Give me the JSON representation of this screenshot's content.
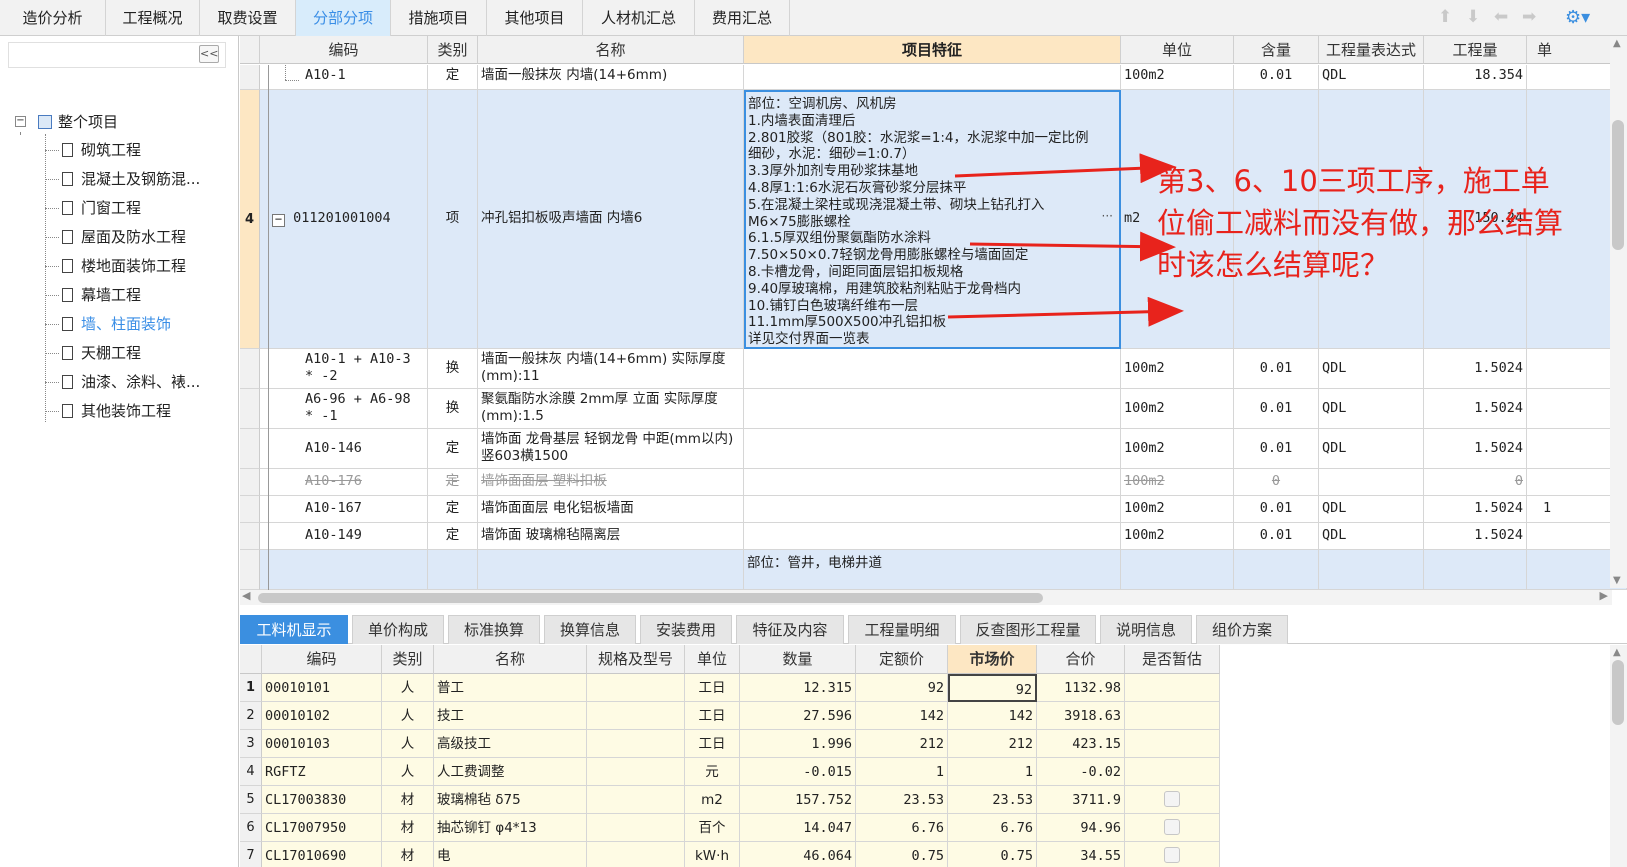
{
  "top_tabs": [
    "造价分析",
    "工程概况",
    "取费设置",
    "分部分项",
    "措施项目",
    "其他项目",
    "人材机汇总",
    "费用汇总"
  ],
  "active_top_tab": "分部分项",
  "toolbar_icons": [
    "arrow-up-icon",
    "arrow-down-icon",
    "arrow-left-icon",
    "arrow-right-icon",
    "settings-icon"
  ],
  "sidebar": {
    "collapse_label": "<<",
    "root": "整个项目",
    "items": [
      "砌筑工程",
      "混凝土及钢筋混...",
      "门窗工程",
      "屋面及防水工程",
      "楼地面装饰工程",
      "幕墙工程",
      "墙、柱面装饰",
      "天棚工程",
      "油漆、涂料、裱...",
      "其他装饰工程"
    ],
    "active_item": "墙、柱面装饰"
  },
  "main_table": {
    "headers": [
      "编码",
      "类别",
      "名称",
      "项目特征",
      "单位",
      "含量",
      "工程量表达式",
      "工程量",
      "单"
    ],
    "selected_header": "项目特征",
    "rows": [
      {
        "num": "",
        "code": "A10-1",
        "type": "定",
        "name": "墙面一般抹灰 内墙(14+6mm)",
        "feature": "",
        "unit": "100m2",
        "content": "0.01",
        "expr": "QDL",
        "qty": "18.354",
        "extra": ""
      },
      {
        "num": "4",
        "code": "011201001004",
        "type": "项",
        "name": "冲孔铝扣板吸声墙面 内墙6",
        "feature_lines": [
          "部位：空调机房、风机房",
          "1.内墙表面清理后",
          "2.801胶浆（801胶：水泥浆=1:4，水泥浆中加一定比例",
          "细砂，水泥：细砂=1:0.7）",
          "3.3厚外加剂专用砂浆抹基地",
          "4.8厚1:1:6水泥石灰膏砂浆分层抹平",
          "5.在混凝土梁柱或现浇混凝土带、砌块上钻孔打入",
          "M6×75膨胀螺栓",
          "6.1.5厚双组份聚氨酯防水涂料",
          "7.50×50×0.7轻钢龙骨用膨胀螺栓与墙面固定",
          "8.卡槽龙骨，间距同面层铝扣板规格",
          "9.40厚玻璃棉，用建筑胶粘剂粘贴于龙骨档内",
          "10.铺钉白色玻璃纤维布一层",
          "11.1mm厚500X500冲孔铝扣板",
          "详见交付界面一览表"
        ],
        "ellipsis": "···",
        "unit": "m2",
        "content": "",
        "expr": "",
        "qty": "150.24",
        "extra": ""
      },
      {
        "num": "",
        "code": "A10-1 + A10-3 * -2",
        "type": "换",
        "name": "墙面一般抹灰 内墙(14+6mm) 实际厚度(mm):11",
        "feature": "",
        "unit": "100m2",
        "content": "0.01",
        "expr": "QDL",
        "qty": "1.5024",
        "extra": ""
      },
      {
        "num": "",
        "code": "A6-96 + A6-98 * -1",
        "type": "换",
        "name": "聚氨酯防水涂膜 2mm厚 立面 实际厚度(mm):1.5",
        "feature": "",
        "unit": "100m2",
        "content": "0.01",
        "expr": "QDL",
        "qty": "1.5024",
        "extra": ""
      },
      {
        "num": "",
        "code": "A10-146",
        "type": "定",
        "name": "墙饰面 龙骨基层 轻钢龙骨 中距(mm以内) 竖603横1500",
        "feature": "",
        "unit": "100m2",
        "content": "0.01",
        "expr": "QDL",
        "qty": "1.5024",
        "extra": ""
      },
      {
        "num": "",
        "code": "A10-176",
        "type": "定",
        "name": "墙饰面面层 塑料扣板",
        "feature": "",
        "unit": "100m2",
        "content": "0",
        "expr": "",
        "qty": "0",
        "extra": ""
      },
      {
        "num": "",
        "code": "A10-167",
        "type": "定",
        "name": "墙饰面面层 电化铝板墙面",
        "feature": "",
        "unit": "100m2",
        "content": "0.01",
        "expr": "QDL",
        "qty": "1.5024",
        "extra": "1"
      },
      {
        "num": "",
        "code": "A10-149",
        "type": "定",
        "name": "墙饰面 玻璃棉毡隔离层",
        "feature": "",
        "unit": "100m2",
        "content": "0.01",
        "expr": "QDL",
        "qty": "1.5024",
        "extra": ""
      },
      {
        "num": "",
        "code": "",
        "type": "",
        "name": "",
        "feature": "部位：管井，电梯井道",
        "unit": "",
        "content": "",
        "expr": "",
        "qty": "",
        "extra": ""
      }
    ]
  },
  "annotation": "第3、6、10三项工序，施工单位偷工减料而没有做，那么结算时该怎么结算呢？",
  "annotation_color": "#e8231c",
  "lower_tabs": [
    "工料机显示",
    "单价构成",
    "标准换算",
    "换算信息",
    "安装费用",
    "特征及内容",
    "工程量明细",
    "反查图形工程量",
    "说明信息",
    "组价方案"
  ],
  "active_lower_tab": "工料机显示",
  "lower_table": {
    "headers": [
      "编码",
      "类别",
      "名称",
      "规格及型号",
      "单位",
      "数量",
      "定额价",
      "市场价",
      "合价",
      "是否暂估"
    ],
    "selected_header": "市场价",
    "rows": [
      {
        "num": "1",
        "code": "00010101",
        "type": "人",
        "name": "普工",
        "spec": "",
        "unit": "工日",
        "qty": "12.315",
        "price": "92",
        "market": "92",
        "total": "1132.98",
        "checkbox": false
      },
      {
        "num": "2",
        "code": "00010102",
        "type": "人",
        "name": "技工",
        "spec": "",
        "unit": "工日",
        "qty": "27.596",
        "price": "142",
        "market": "142",
        "total": "3918.63",
        "checkbox": false
      },
      {
        "num": "3",
        "code": "00010103",
        "type": "人",
        "name": "高级技工",
        "spec": "",
        "unit": "工日",
        "qty": "1.996",
        "price": "212",
        "market": "212",
        "total": "423.15",
        "checkbox": false
      },
      {
        "num": "4",
        "code": "RGFTZ",
        "type": "人",
        "name": "人工费调整",
        "spec": "",
        "unit": "元",
        "qty": "-0.015",
        "price": "1",
        "market": "1",
        "total": "-0.02",
        "checkbox": false
      },
      {
        "num": "5",
        "code": "CL17003830",
        "type": "材",
        "name": "玻璃棉毡 δ75",
        "spec": "",
        "unit": "m2",
        "qty": "157.752",
        "price": "23.53",
        "market": "23.53",
        "total": "3711.9",
        "checkbox": true
      },
      {
        "num": "6",
        "code": "CL17007950",
        "type": "材",
        "name": "抽芯铆钉 φ4*13",
        "spec": "",
        "unit": "百个",
        "qty": "14.047",
        "price": "6.76",
        "market": "6.76",
        "total": "94.96",
        "checkbox": true
      },
      {
        "num": "7",
        "code": "CL17010690",
        "type": "材",
        "name": "电",
        "spec": "",
        "unit": "kW·h",
        "qty": "46.064",
        "price": "0.75",
        "market": "0.75",
        "total": "34.55",
        "checkbox": true
      }
    ]
  },
  "colors": {
    "accent": "#3b8fe0",
    "selected_row": "#dde9f8",
    "yellow_row": "#fefbe4",
    "header_selected": "#fde7c3"
  }
}
